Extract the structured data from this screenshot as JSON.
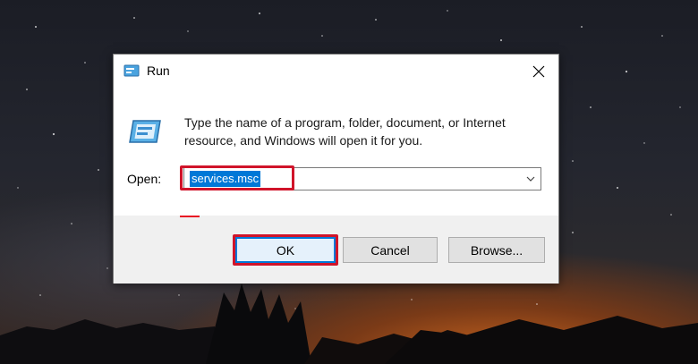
{
  "dialog": {
    "title": "Run",
    "title_icon": "run-icon",
    "close_icon": "close-icon",
    "description_line1": "Type the name of a program, folder, document, or Internet",
    "description_line2": "resource, and Windows will open it for you.",
    "open_label": "Open:",
    "open_value": "services.msc",
    "dropdown_icon": "chevron-down-icon"
  },
  "buttons": {
    "ok": "OK",
    "cancel": "Cancel",
    "browse": "Browse..."
  },
  "colors": {
    "selection": "#0078d7",
    "highlight": "#d0142a"
  }
}
